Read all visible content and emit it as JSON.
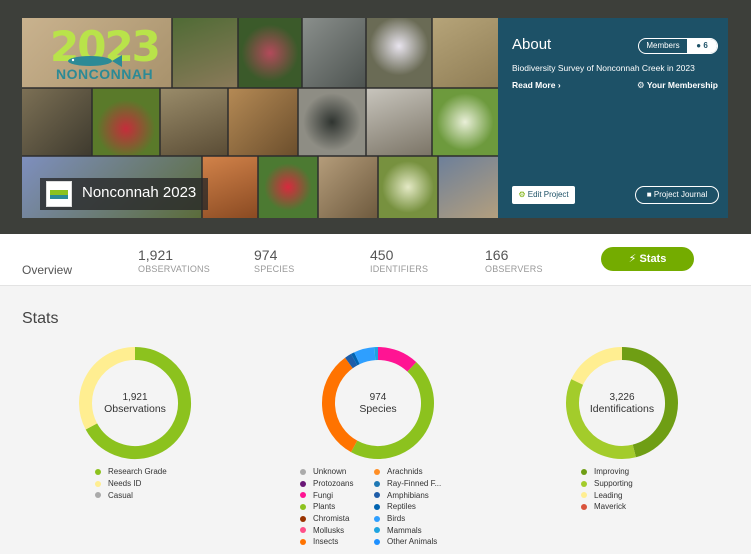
{
  "banner": {
    "logo": {
      "year": "2023",
      "name": "NONCONNAH"
    },
    "project_title": "Nonconnah 2023"
  },
  "about": {
    "title": "About",
    "members_label": "Members",
    "members_count": "6",
    "description": "Biodiversity Survey of Nonconnah Creek in 2023",
    "read_more": "Read More ›",
    "membership": "Your Membership",
    "edit_project": "Edit Project",
    "project_journal": "Project Journal"
  },
  "statbar": {
    "overview": "Overview",
    "items": [
      {
        "value": "1,921",
        "label": "OBSERVATIONS"
      },
      {
        "value": "974",
        "label": "SPECIES"
      },
      {
        "value": "450",
        "label": "IDENTIFIERS"
      },
      {
        "value": "166",
        "label": "OBSERVERS"
      }
    ],
    "stats_button": "Stats"
  },
  "stats": {
    "heading": "Stats"
  },
  "chart_data": [
    {
      "type": "pie",
      "center_value": "1,921",
      "center_label": "Observations",
      "categories": [
        "Research Grade",
        "Needs ID",
        "Casual"
      ],
      "values": [
        1290,
        631,
        0
      ],
      "colors": [
        "#8cc21e",
        "#ffee91",
        "#aaaaaa"
      ]
    },
    {
      "type": "pie",
      "center_value": "974",
      "center_label": "Species",
      "categories": [
        "Unknown",
        "Protozoans",
        "Fungi",
        "Plants",
        "Chromista",
        "Mollusks",
        "Insects",
        "Arachnids",
        "Ray-Finned F...",
        "Amphibians",
        "Reptiles",
        "Birds",
        "Mammals",
        "Other Animals"
      ],
      "values": [
        0,
        0,
        0.12,
        0.46,
        0,
        0,
        0.32,
        0,
        0,
        0.02,
        0.01,
        0.06,
        0.01,
        0
      ],
      "colors": [
        "#aaaaaa",
        "#691776",
        "#ff1493",
        "#8cc21e",
        "#993300",
        "#ff4f89",
        "#ff7300",
        "#ff8e24",
        "#1f78b4",
        "#1e5da8",
        "#0063b0",
        "#2e9fff",
        "#1ea4e0",
        "#1e90ff"
      ]
    },
    {
      "type": "pie",
      "center_value": "3,226",
      "center_label": "Identifications",
      "categories": [
        "Improving",
        "Supporting",
        "Leading",
        "Maverick"
      ],
      "values": [
        0.46,
        0.36,
        0.18,
        0
      ],
      "colors": [
        "#6f9e14",
        "#a3cc2b",
        "#ffee91",
        "#d9533b"
      ]
    }
  ]
}
